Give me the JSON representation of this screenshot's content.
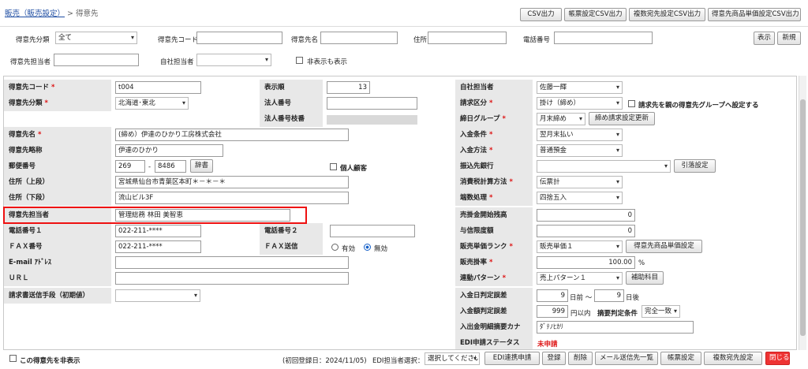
{
  "breadcrumb": {
    "link": "販売（販売設定）",
    "sep": " > ",
    "current": "得意先"
  },
  "toolbar": [
    "CSV出力",
    "帳票設定CSV出力",
    "複数宛先設定CSV出力",
    "得意先商品単価設定CSV出力"
  ],
  "filter": {
    "category_label": "得意先分類",
    "category_value": "全て",
    "code_label": "得意先コード",
    "name_label": "得意先名",
    "address_label": "住所",
    "phone_label": "電話番号",
    "contact_label": "得意先担当者",
    "staff_label": "自社担当者",
    "hidden_label": "非表示も表示",
    "show_btn": "表示",
    "new_btn": "新規"
  },
  "form": {
    "code_label": "得意先コード",
    "code_value": "t004",
    "category_label": "得意先分類",
    "category_value": "北海道･東北",
    "name_label": "得意先名",
    "name_value": "(締め）伊達のひかり工房株式会社",
    "short_label": "得意先略称",
    "short_value": "伊達のひかり",
    "zip_label": "郵便番号",
    "zip1": "269",
    "zip_sep": "-",
    "zip2": "8486",
    "dict_btn": "辞書",
    "addr1_label": "住所（上段）",
    "addr1_value": "宮城県仙台市青葉区本町＊－＊－＊",
    "addr2_label": "住所（下段）",
    "addr2_value": "流山ビル3F",
    "contact_label": "得意先担当者",
    "contact_value": "管理総務 林田 美智恵",
    "phone1_label": "電話番号１",
    "phone1_value": "022-211-****",
    "fax_label": "ＦＡＸ番号",
    "fax_value": "022-211-****",
    "email_label": "E-mail ｱﾄﾞﾚｽ",
    "url_label": "ＵＲＬ",
    "invoice_method_label": "請求書送信手段（初期値）",
    "order_label": "表示順",
    "order_value": "13",
    "corp_label": "法人番号",
    "corp_branch_label": "法人番号枝番",
    "personal_label": "個人顧客",
    "phone2_label": "電話番号２",
    "fax_send_label": "ＦＡＸ送信",
    "fax_opt1": "有効",
    "fax_opt2": "無効",
    "staff_label": "自社担当者",
    "staff_value": "佐藤一輝",
    "billing_label": "請求区分",
    "billing_value": "掛け（締め）",
    "parent_label": "請求先を親の得意先グループへ設定する",
    "closing_label": "締日グループ",
    "closing_value": "月末締め",
    "closing_btn": "締め請求設定更新",
    "pay_cond_label": "入金条件",
    "pay_cond_value": "翌月末払い",
    "pay_method_label": "入金方法",
    "pay_method_value": "普通預金",
    "bank_label": "振込先銀行",
    "bank_btn": "引落設定",
    "tax_label": "消費税計算方法",
    "tax_value": "伝票計",
    "round_label": "端数処理",
    "round_value": "四捨五入",
    "ar_label": "売掛金開始残高",
    "ar_value": "0",
    "credit_label": "与信限度額",
    "credit_value": "0",
    "rank_label": "販売単価ランク",
    "rank_value": "販売単価１",
    "rank_btn": "得意先商品単価設定",
    "rate_label": "販売掛率",
    "rate_value": "100.00",
    "rate_unit": "%",
    "pattern_label": "連動パターン",
    "pattern_value": "売上パターン１",
    "pattern_btn": "補助科目",
    "date_label": "入金日判定誤差",
    "date1": "9",
    "date1_unit": "日前 ～",
    "date2": "9",
    "date2_unit": "日後",
    "amount_label": "入金額判定誤差",
    "amount_value": "999",
    "amount_unit": "円以内",
    "summary_label": "摘要判定条件",
    "summary_value": "完全一致",
    "kana_label": "入出金明細摘要カナ",
    "kana_value": "ﾀﾞﾃﾉﾋｶﾘ",
    "edi_label": "EDI申請ステータス",
    "edi_value": "未申請"
  },
  "footer": {
    "hide_label": "この得意先を非表示",
    "reg_info": "(初回登録日：2024/11/05)",
    "edi_person_label": "EDI担当者選択：",
    "edi_person_value": "選択してください",
    "buttons": [
      "EDI連携申請",
      "登録",
      "削除",
      "メール送信先一覧",
      "帳票設定",
      "複数宛先設定",
      "閉じる"
    ]
  }
}
